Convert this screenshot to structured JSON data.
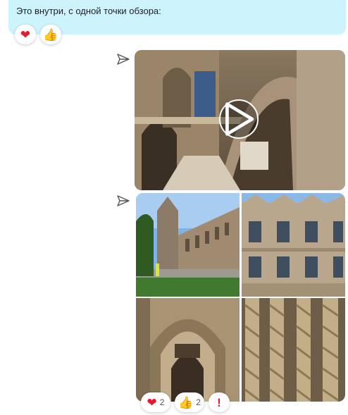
{
  "message": {
    "text": "Это внутри, с одной точки обзора:",
    "reactions": [
      {
        "icon": "heart-icon",
        "glyph": "❤"
      },
      {
        "icon": "thumbs-up-icon",
        "glyph": "👍"
      }
    ]
  },
  "media_reactions": [
    {
      "icon": "heart-icon",
      "glyph": "❤",
      "count": "2"
    },
    {
      "icon": "thumbs-up-icon",
      "glyph": "👍",
      "count": "2"
    },
    {
      "icon": "exclamation-icon",
      "glyph": "!"
    }
  ],
  "colors": {
    "bubble_bg": "#cdf3fd",
    "heart": "#e8192c",
    "thumb": "#f5b400"
  }
}
